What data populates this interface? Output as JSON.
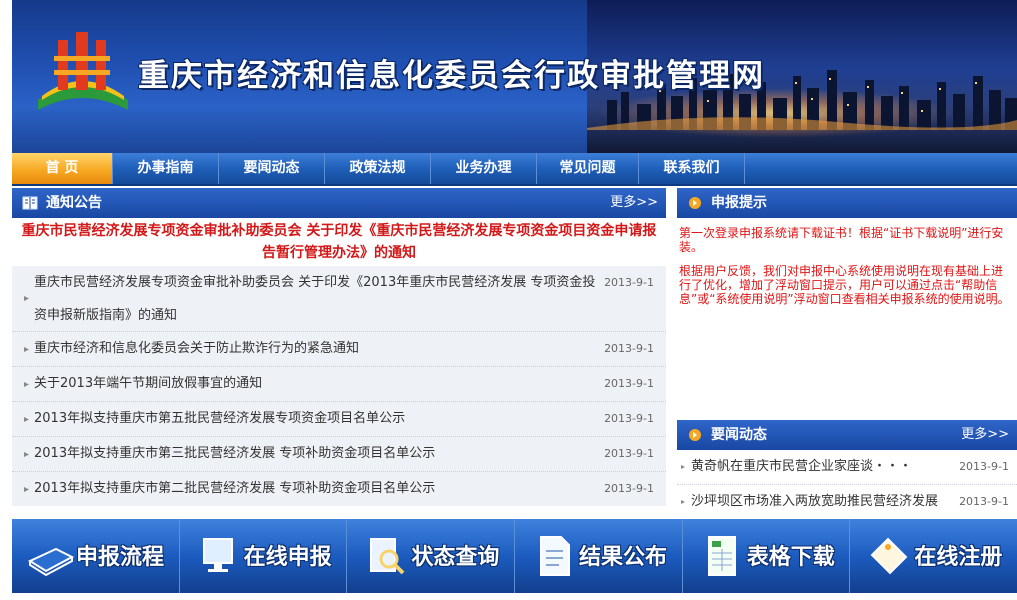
{
  "header": {
    "title": "重庆市经济和信息化委员会行政审批管理网"
  },
  "nav": {
    "items": [
      "首  页",
      "办事指南",
      "要闻动态",
      "政策法规",
      "业务办理",
      "常见问题",
      "联系我们"
    ]
  },
  "notice": {
    "title": "通知公告",
    "more": "更多>>",
    "headline": "重庆市民营经济发展专项资金审批补助委员会 关于印发《重庆市民营经济发展专项资金项目资金申请报告暂行管理办法》的通知",
    "items": [
      {
        "text": "重庆市民营经济发展专项资金审批补助委员会 关于印发《2013年重庆市民营经济发展 专项资金投资申报新版指南》的通知",
        "date": "2013-9-1"
      },
      {
        "text": "重庆市经济和信息化委员会关于防止欺诈行为的紧急通知",
        "date": "2013-9-1"
      },
      {
        "text": "关于2013年端午节期间放假事宜的通知",
        "date": "2013-9-1"
      },
      {
        "text": "2013年拟支持重庆市第五批民营经济发展专项资金项目名单公示",
        "date": "2013-9-1"
      },
      {
        "text": "2013年拟支持重庆市第三批民营经济发展 专项补助资金项目名单公示",
        "date": "2013-9-1"
      },
      {
        "text": "2013年拟支持重庆市第二批民营经济发展 专项补助资金项目名单公示",
        "date": "2013-9-1"
      }
    ]
  },
  "tips": {
    "title": "申报提示",
    "p1": "第一次登录申报系统请下载证书！根据“证书下载说明”进行安装。",
    "p2": "根据用户反馈，我们对申报中心系统使用说明在现有基础上进行了优化，增加了浮动窗口提示，用户可以通过点击“帮助信息”或“系统使用说明”浮动窗口查看相关申报系统的使用说明。"
  },
  "news": {
    "title": "要闻动态",
    "more": "更多>>",
    "items": [
      {
        "text": "黄奇帆在重庆市民营企业家座谈・・・",
        "date": "2013-9-1"
      },
      {
        "text": "沙坪坝区市场准入两放宽助推民营经济发展",
        "date": "2013-9-1"
      }
    ]
  },
  "bottom": {
    "buttons": [
      "申报流程",
      "在线申报",
      "状态查询",
      "结果公布",
      "表格下载",
      "在线注册"
    ]
  },
  "colors": {
    "accent": "#1848a3",
    "headline": "#d21818",
    "active_tab": "#f7a823"
  }
}
